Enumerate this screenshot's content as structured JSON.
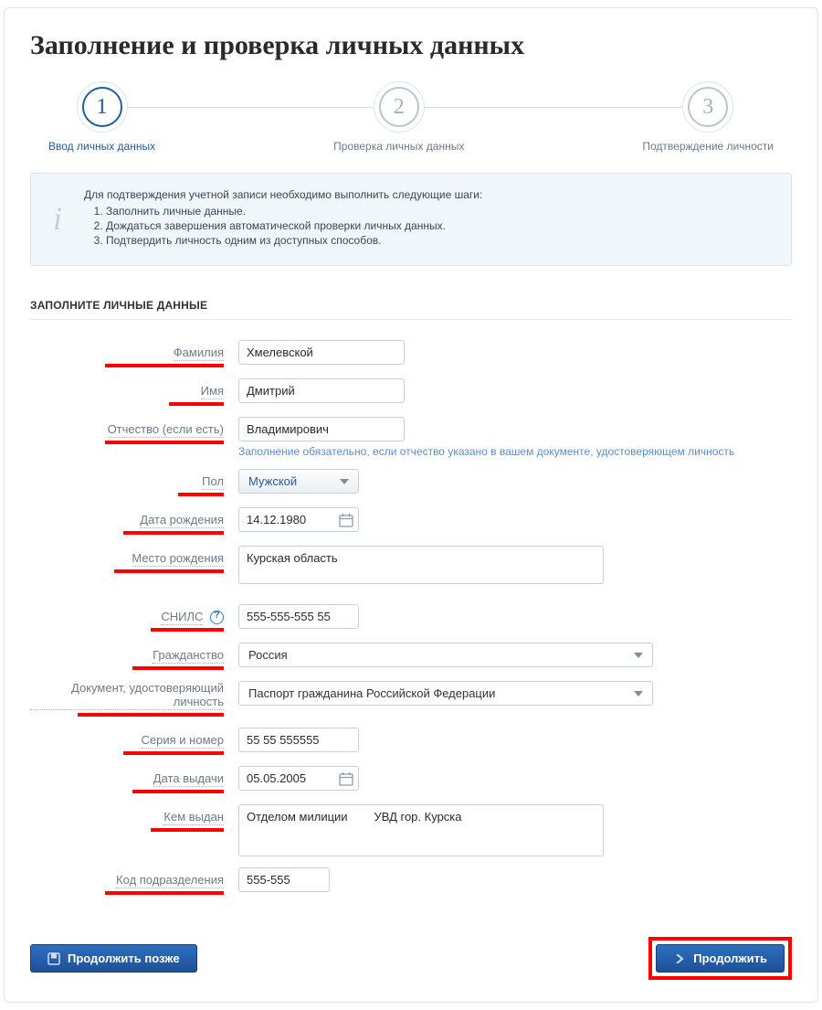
{
  "page_title": "Заполнение и проверка личных данных",
  "stepper": {
    "steps": [
      {
        "num": "1",
        "label": "Ввод личных данных"
      },
      {
        "num": "2",
        "label": "Проверка личных данных"
      },
      {
        "num": "3",
        "label": "Подтверждение личности"
      }
    ]
  },
  "info": {
    "lead": "Для подтверждения учетной записи необходимо выполнить следующие шаги:",
    "items": [
      "Заполнить личные данные.",
      "Дождаться завершения автоматической проверки личных данных.",
      "Подтвердить личность одним из доступных способов."
    ]
  },
  "section_title": "ЗАПОЛНИТЕ ЛИЧНЫЕ ДАННЫЕ",
  "fields": {
    "surname": {
      "label": "Фамилия",
      "value": "Хмелевской"
    },
    "name": {
      "label": "Имя",
      "value": "Дмитрий"
    },
    "patronymic": {
      "label": "Отчество (если есть)",
      "value": "Владимирович",
      "hint": "Заполнение обязательно, если отчество указано в вашем документе, удостоверяющем личность"
    },
    "gender": {
      "label": "Пол",
      "value": "Мужской"
    },
    "birthdate": {
      "label": "Дата рождения",
      "value": "14.12.1980"
    },
    "birthplace": {
      "label": "Место рождения",
      "value": "Курская область"
    },
    "snils": {
      "label": "СНИЛС",
      "value": "555-555-555 55"
    },
    "citizenship": {
      "label": "Гражданство",
      "value": "Россия"
    },
    "doc_type": {
      "label": "Документ, удостоверяющий личность",
      "value": "Паспорт гражданина Российской Федерации"
    },
    "doc_series": {
      "label": "Серия и номер",
      "value": "55 55 555555"
    },
    "doc_issue_date": {
      "label": "Дата выдачи",
      "value": "05.05.2005"
    },
    "doc_issued_by": {
      "label": "Кем выдан",
      "value": "Отделом милиции        УВД гор. Курска"
    },
    "doc_unit_code": {
      "label": "Код подразделения",
      "value": "555-555"
    }
  },
  "buttons": {
    "later": "Продолжить позже",
    "continue": "Продолжить"
  }
}
